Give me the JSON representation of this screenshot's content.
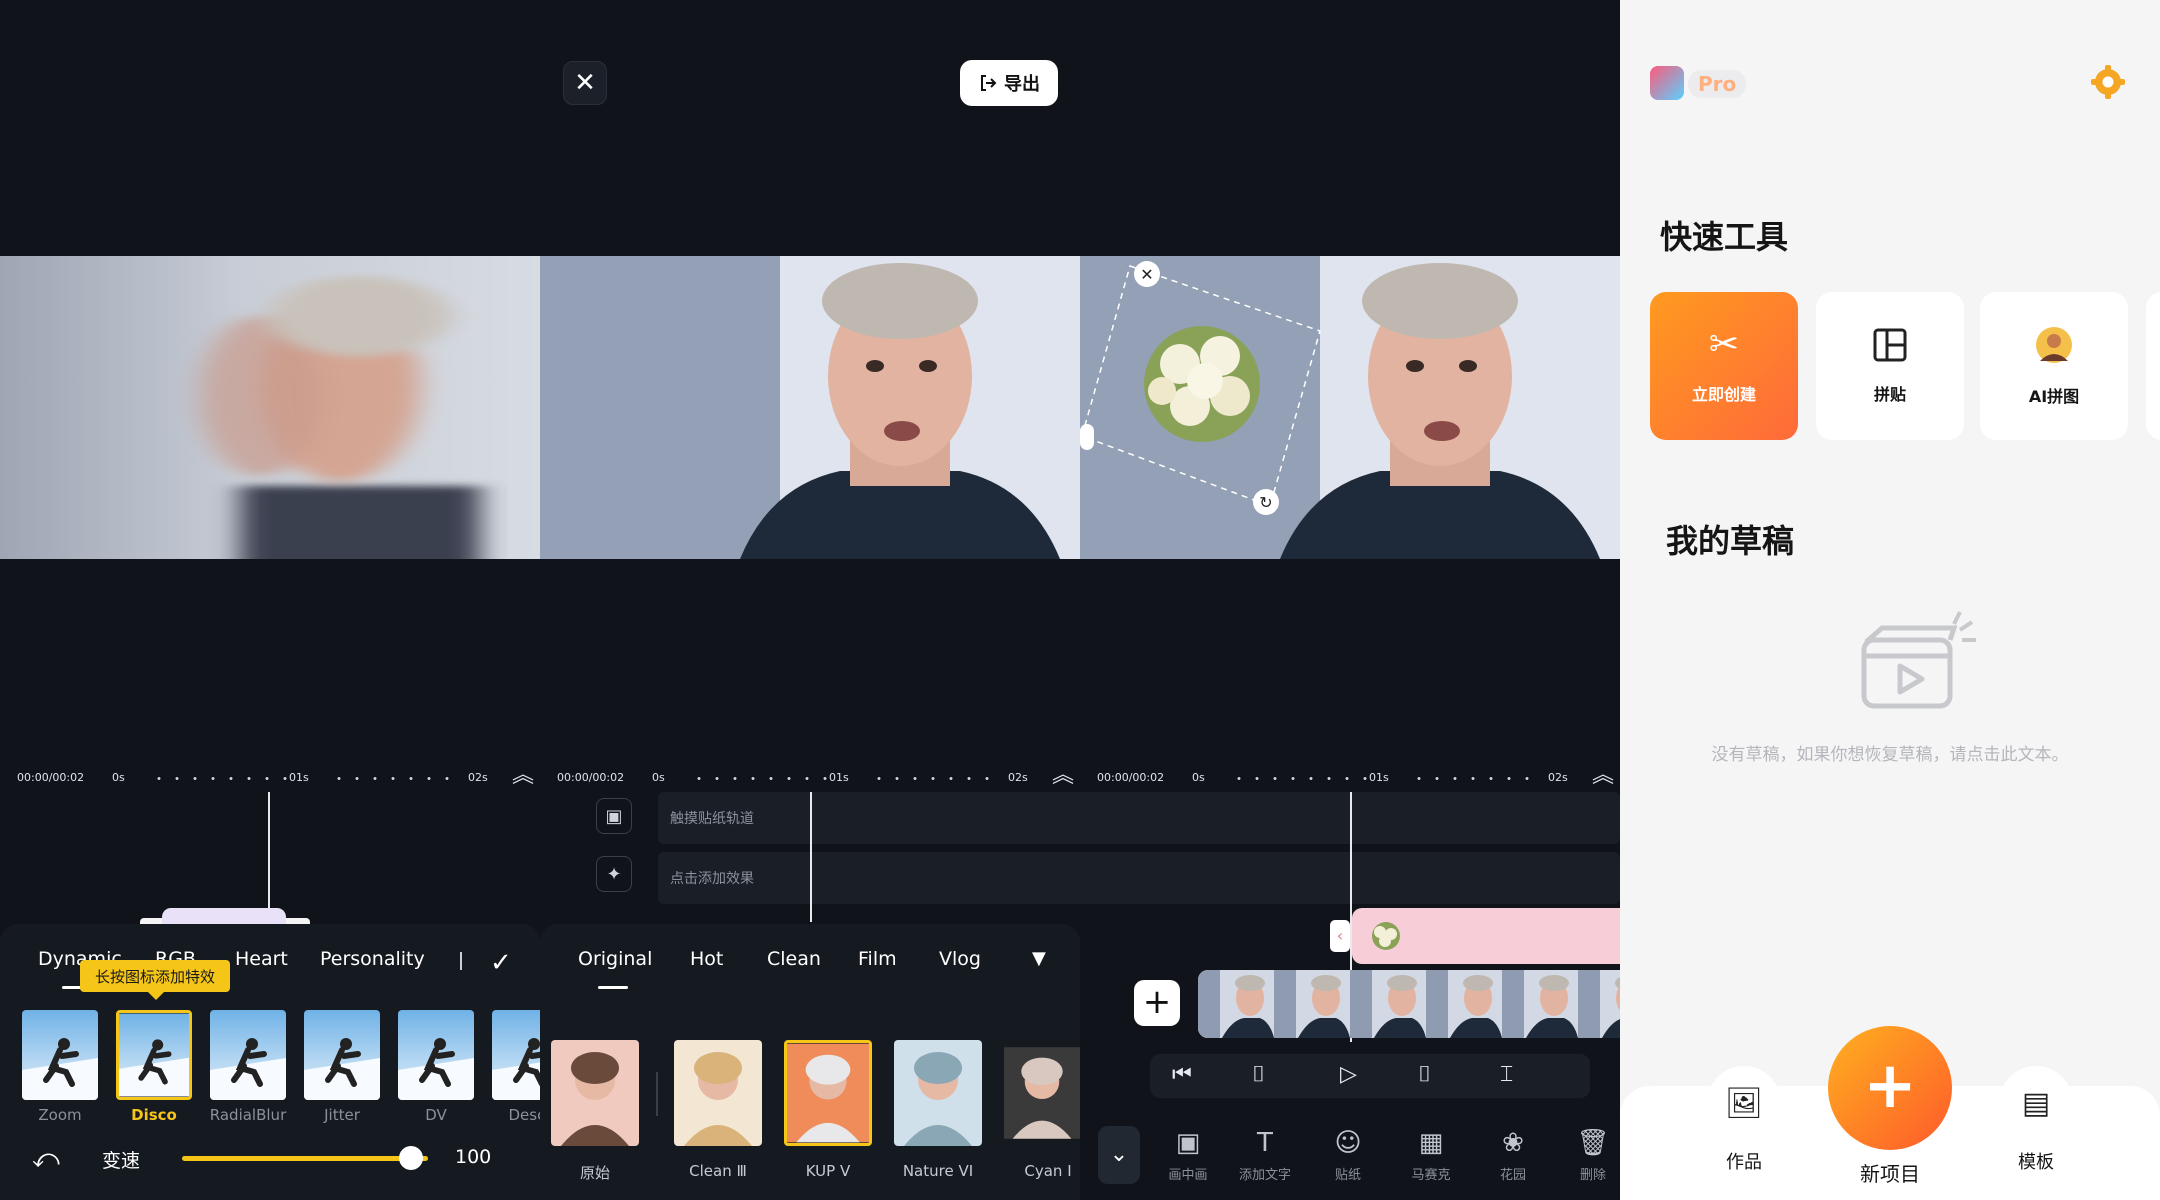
{
  "toolbar": {
    "close_icon": "close-icon",
    "export_label": "导出"
  },
  "timeline": {
    "time": "00:00/00:02",
    "marks": [
      "0s",
      "01s",
      "02s"
    ]
  },
  "effects_panel": {
    "tabs": [
      "Dynamic",
      "RGB",
      "Heart",
      "Personality"
    ],
    "tooltip": "长按图标添加特效",
    "effects": [
      {
        "label": "Zoom",
        "selected": false
      },
      {
        "label": "Disco",
        "selected": true
      },
      {
        "label": "RadialBlur",
        "selected": false
      },
      {
        "label": "Jitter",
        "selected": false
      },
      {
        "label": "DV",
        "selected": false
      },
      {
        "label": "Descr",
        "selected": false
      }
    ],
    "speed_label": "变速",
    "speed_value": "100",
    "speed_fraction": 0.93
  },
  "filter_panel": {
    "track_sticker": "触摸贴纸轨道",
    "track_effect": "点击添加效果",
    "tabs": [
      "Original",
      "Hot",
      "Clean",
      "Film",
      "Vlog"
    ],
    "filters": [
      {
        "label": "原始",
        "selected": false
      },
      {
        "label": "Clean Ⅲ",
        "selected": false
      },
      {
        "label": "KUP V",
        "selected": true
      },
      {
        "label": "Nature VI",
        "selected": false
      },
      {
        "label": "Cyan Ⅰ",
        "selected": false
      }
    ]
  },
  "sticker_panel": {
    "tools": [
      "画中画",
      "添加文字",
      "贴纸",
      "马赛克",
      "花园",
      "删除"
    ]
  },
  "home": {
    "pro_label": "Pro",
    "quick_tools_title": "快速工具",
    "cards": [
      "立即创建",
      "拼贴",
      "AI拼图"
    ],
    "drafts_title": "我的草稿",
    "empty_text": "没有草稿，如果你想恢复草稿，请点击此文本。",
    "nav": {
      "works": "作品",
      "new_project": "新项目",
      "templates": "模板"
    }
  },
  "colors": {
    "accent": "#f5c518",
    "orange": "#ff7a2a",
    "editor_bg": "#10141a"
  }
}
